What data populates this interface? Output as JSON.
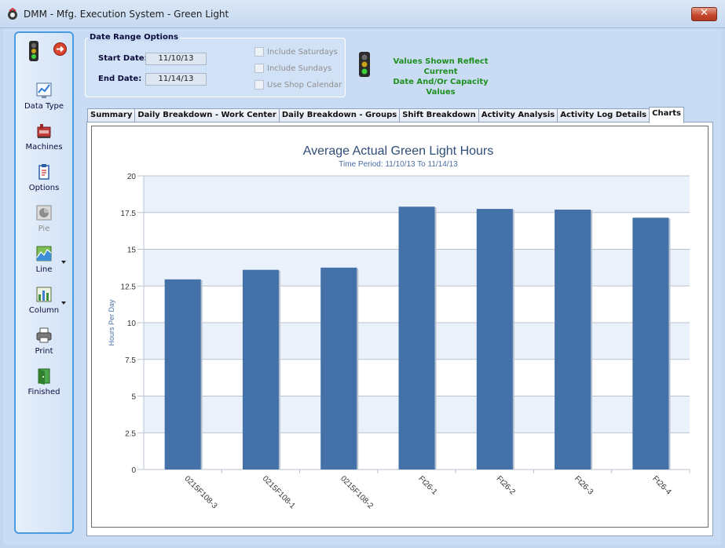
{
  "window": {
    "title": "DMM - Mfg. Execution System - Green Light",
    "close_label": "✕"
  },
  "toolbar": {
    "items": [
      {
        "label": "Data Type",
        "icon": "data-type-chart-icon",
        "enabled": true
      },
      {
        "label": "Machines",
        "icon": "machines-icon",
        "enabled": true
      },
      {
        "label": "Options",
        "icon": "options-clipboard-icon",
        "enabled": true
      },
      {
        "label": "Pie",
        "icon": "pie-chart-icon",
        "enabled": false
      },
      {
        "label": "Line",
        "icon": "line-chart-icon",
        "enabled": true
      },
      {
        "label": "Column",
        "icon": "column-chart-icon",
        "enabled": true
      },
      {
        "label": "Print",
        "icon": "printer-icon",
        "enabled": true
      },
      {
        "label": "Finished",
        "icon": "finished-exit-icon",
        "enabled": true
      }
    ]
  },
  "date_range": {
    "title": "Date Range Options",
    "start_label": "Start Date:",
    "start_value": "11/10/13",
    "end_label": "End Date:",
    "end_value": "11/14/13",
    "options": [
      {
        "label": "Include Saturdays",
        "checked": false
      },
      {
        "label": "Include Sundays",
        "checked": false
      },
      {
        "label": "Use Shop Calendar",
        "checked": false
      }
    ]
  },
  "note": {
    "line1": "Values Shown Reflect Current",
    "line2": "Date And/Or Capacity Values",
    "color": "#1f8f1f"
  },
  "tabs": [
    {
      "label": "Summary",
      "active": false
    },
    {
      "label": "Daily Breakdown - Work Center",
      "active": false
    },
    {
      "label": "Daily Breakdown - Groups",
      "active": false
    },
    {
      "label": "Shift Breakdown",
      "active": false
    },
    {
      "label": "Activity Analysis",
      "active": false
    },
    {
      "label": "Activity Log Details",
      "active": false
    },
    {
      "label": "Charts",
      "active": true
    }
  ],
  "chart_data": {
    "type": "bar",
    "title": "Average Actual Green Light Hours",
    "subtitle": "Time Period: 11/10/13 To 11/14/13",
    "ylabel": "Hours Per Day",
    "xlabel": "",
    "categories": [
      "0215F108-3",
      "0215F108-1",
      "0215F108-2",
      "Ft26-1",
      "Ft26-2",
      "Ft26-3",
      "Ft26-4"
    ],
    "values": [
      12.95,
      13.6,
      13.75,
      17.9,
      17.75,
      17.7,
      17.15
    ],
    "ylim": [
      0,
      20
    ],
    "yticks": [
      "0",
      "2.5",
      "5",
      "7.5",
      "10",
      "12.5",
      "15",
      "17.5",
      "20"
    ],
    "grid": true,
    "bar_color": "#4472a8",
    "band_color": "#eaf1fb"
  }
}
